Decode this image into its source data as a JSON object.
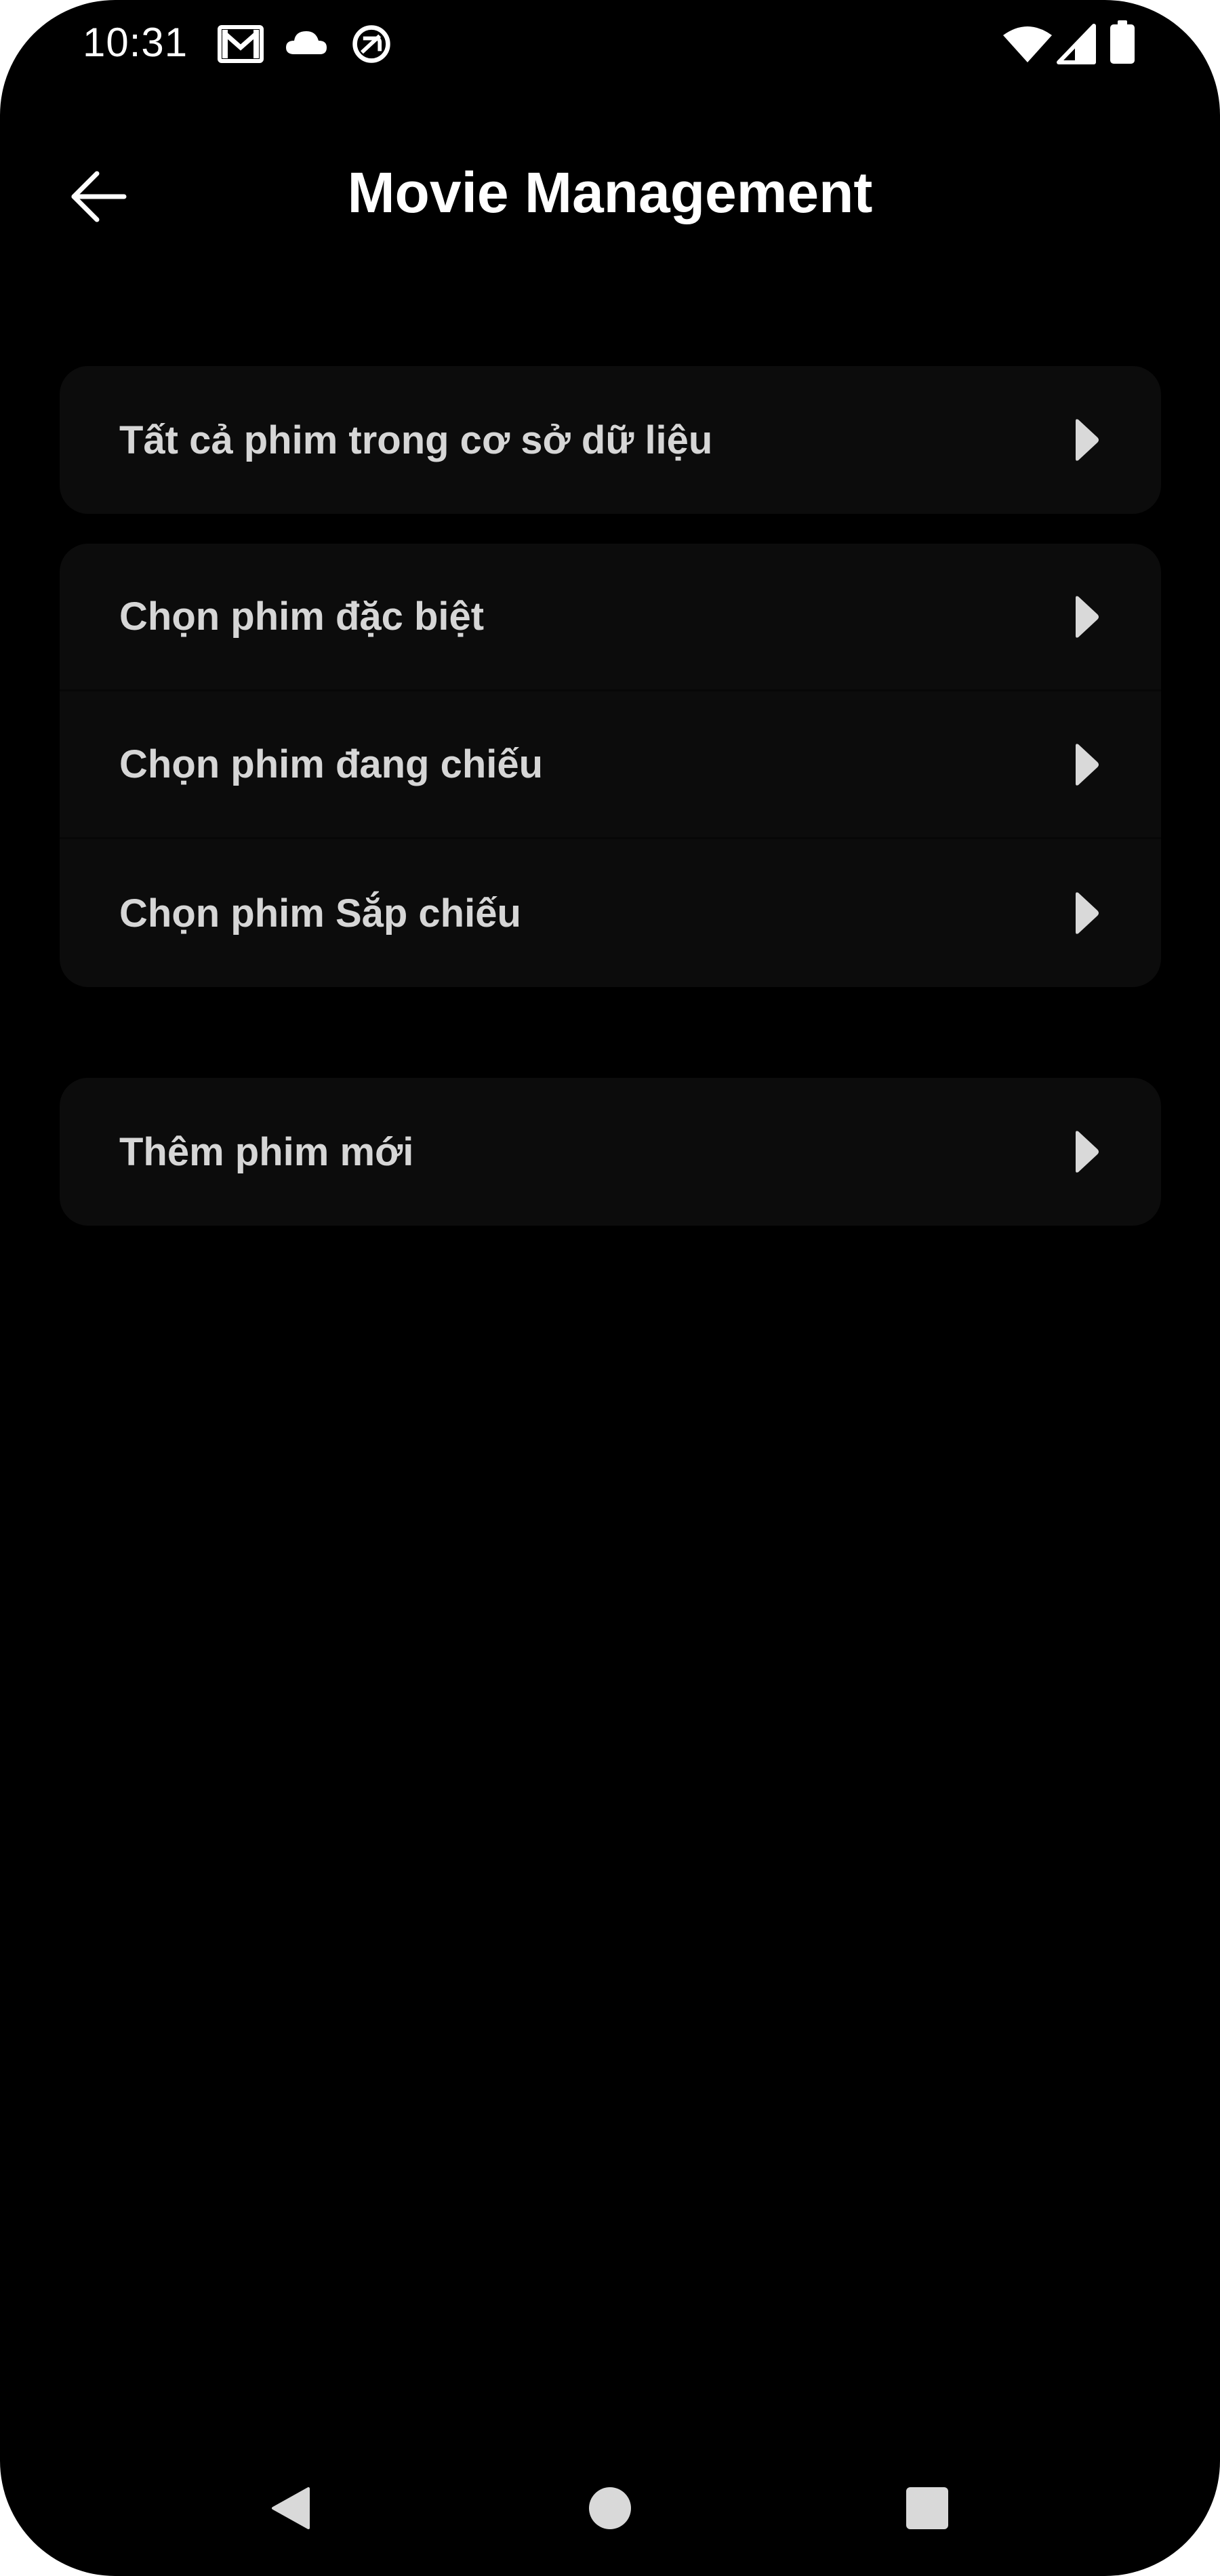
{
  "status_bar": {
    "time": "10:31",
    "left_icons": [
      "gmail-icon",
      "cloud-icon",
      "vpn-icon"
    ],
    "right_icons": [
      "wifi-icon",
      "signal-icon",
      "battery-icon"
    ]
  },
  "app_bar": {
    "title": "Movie Management",
    "back_icon": "arrow-left-icon"
  },
  "menu": {
    "group1": [
      {
        "label": "Tất cả phim trong cơ sở dữ liệu",
        "icon": "play-arrow-icon"
      }
    ],
    "group2": [
      {
        "label": "Chọn phim đặc biệt",
        "icon": "play-arrow-icon"
      },
      {
        "label": "Chọn phim đang chiếu",
        "icon": "play-arrow-icon"
      },
      {
        "label": "Chọn phim Sắp chiếu",
        "icon": "play-arrow-icon"
      }
    ],
    "group3": [
      {
        "label": "Thêm phim mới",
        "icon": "play-arrow-icon"
      }
    ]
  },
  "nav_bar": {
    "buttons": [
      "back-triangle-icon",
      "home-circle-icon",
      "recents-square-icon"
    ]
  },
  "colors": {
    "background": "#000000",
    "card": "#0c0c0c",
    "text_primary": "#ffffff",
    "text_item": "#d6d6d6",
    "arrow": "#d9d9d9",
    "nav_icon": "#d9d9d9"
  }
}
